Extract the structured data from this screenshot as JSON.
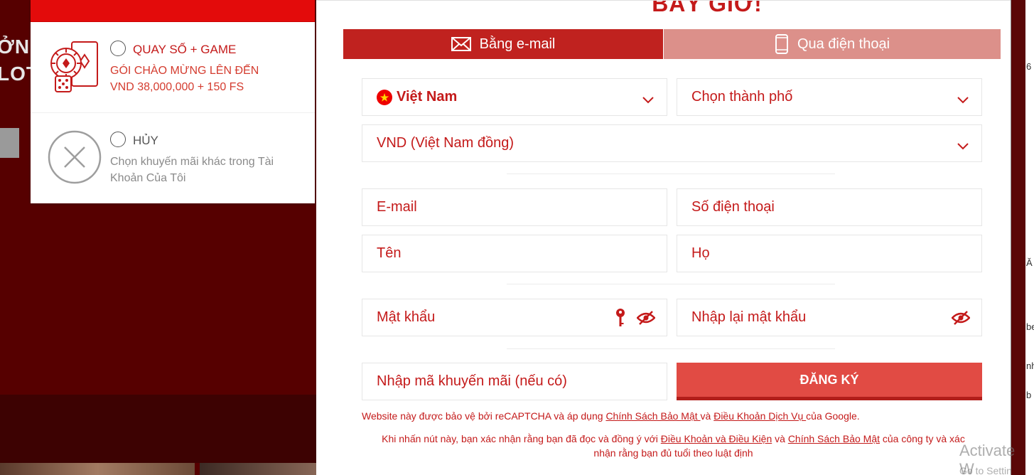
{
  "background": {
    "frag_line1": "ỞN",
    "frag_line2": "LOT",
    "right_frags": [
      "6",
      "Ă",
      "be",
      "nh",
      "b"
    ]
  },
  "promo": {
    "options": [
      {
        "title": "QUAY SỐ + GAME",
        "desc_line1": "GÓI CHÀO MỪNG LÊN ĐẾN",
        "desc_line2": "VND 38,000,000 + 150 FS"
      },
      {
        "title": "HỦY",
        "desc_line1": "Chọn khuyến mãi khác trong Tài",
        "desc_line2": "Khoản Của Tôi"
      }
    ]
  },
  "modal": {
    "title": "BÂY GIỜ!",
    "tabs": {
      "email_label": "Bằng e-mail",
      "phone_label": "Qua điện thoại"
    },
    "fields": {
      "country": "Việt Nam",
      "city": "Chọn thành phố",
      "currency": "VND (Việt Nam đồng)",
      "email": "E-mail",
      "phone": "Số điện thoại",
      "first_name": "Tên",
      "last_name": "Họ",
      "password": "Mật khẩu",
      "password_confirm": "Nhập lại mật khẩu",
      "promo_code": "Nhập mã khuyến mãi (nếu có)"
    },
    "submit_label": "ĐĂNG KÝ",
    "recaptcha": {
      "text_before": "Website này được bảo vệ bởi reCAPTCHA và áp dụng ",
      "privacy_link": "Chính Sách Bảo Mật ",
      "and": "và ",
      "terms_link": "Điều Khoản Dịch Vụ ",
      "text_after": "của Google."
    },
    "consent": {
      "text_before": "Khi nhấn nút này, bạn xác nhận rằng bạn đã đọc và đồng ý với ",
      "terms_link": "Điều Khoản và Điều Kiện",
      "and": " và ",
      "privacy_link": "Chính Sách Bảo Mật",
      "text_after": " của công ty và xác",
      "line2": "nhận rằng bạn đủ tuổi theo luật định"
    }
  },
  "watermark": {
    "line1": "Activate W",
    "line2": "Go to Settin"
  },
  "colors": {
    "brand_red": "#c0221f",
    "tab_inactive": "#dc908a",
    "button": "#e14b44",
    "bg_dark": "#560000"
  }
}
